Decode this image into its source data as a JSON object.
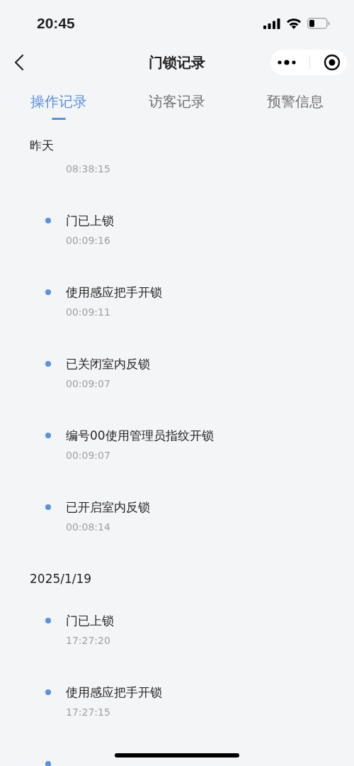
{
  "status_bar": {
    "time": "20:45"
  },
  "nav": {
    "title": "门锁记录"
  },
  "tabs": [
    {
      "label": "操作记录",
      "selected": true
    },
    {
      "label": "访客记录",
      "selected": false
    },
    {
      "label": "预警信息",
      "selected": false
    }
  ],
  "sections": [
    {
      "date": "昨天",
      "records": [
        {
          "kind": "time_only",
          "time": "08:38:15"
        },
        {
          "kind": "full",
          "title": "门已上锁",
          "time": "00:09:16"
        },
        {
          "kind": "full",
          "title": "使用感应把手开锁",
          "time": "00:09:11"
        },
        {
          "kind": "full",
          "title": "已关闭室内反锁",
          "time": "00:09:07"
        },
        {
          "kind": "full",
          "title": "编号00使用管理员指纹开锁",
          "time": "00:09:07"
        },
        {
          "kind": "full",
          "title": "已开启室内反锁",
          "time": "00:08:14"
        }
      ]
    },
    {
      "date": "2025/1/19",
      "records": [
        {
          "kind": "full",
          "title": "门已上锁",
          "time": "17:27:20"
        },
        {
          "kind": "full",
          "title": "使用感应把手开锁",
          "time": "17:27:15"
        },
        {
          "kind": "bullet_only"
        }
      ]
    }
  ]
}
